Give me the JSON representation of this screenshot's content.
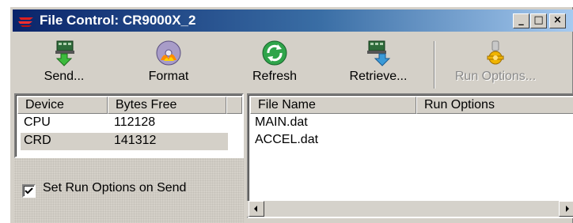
{
  "window": {
    "title": "File Control: CR9000X_2",
    "minimize_glyph": "_",
    "maximize_glyph": "□",
    "close_glyph": "×"
  },
  "toolbar": {
    "buttons": [
      {
        "label": "Send...",
        "icon": "send-icon",
        "enabled": true
      },
      {
        "label": "Format",
        "icon": "format-icon",
        "enabled": true
      },
      {
        "label": "Refresh",
        "icon": "refresh-icon",
        "enabled": true
      },
      {
        "label": "Retrieve...",
        "icon": "retrieve-icon",
        "enabled": true
      },
      {
        "label": "Run Options...",
        "icon": "run-options-icon",
        "enabled": false
      }
    ]
  },
  "devices": {
    "columns": [
      "Device",
      "Bytes Free"
    ],
    "rows": [
      {
        "device": "CPU",
        "bytes_free": "112128",
        "selected": false
      },
      {
        "device": "CRD",
        "bytes_free": "141312",
        "selected": true
      }
    ]
  },
  "set_run_options": {
    "label": "Set Run Options on Send",
    "checked": true
  },
  "files": {
    "columns": [
      "File Name",
      "Run Options"
    ],
    "rows": [
      {
        "name": "MAIN.dat",
        "run_options": ""
      },
      {
        "name": "ACCEL.dat",
        "run_options": ""
      }
    ]
  },
  "colors": {
    "title_bar_start": "#0a246a",
    "title_bar_end": "#a6caf0",
    "face": "#d4d0c8",
    "selection": "#d4d0c8"
  }
}
